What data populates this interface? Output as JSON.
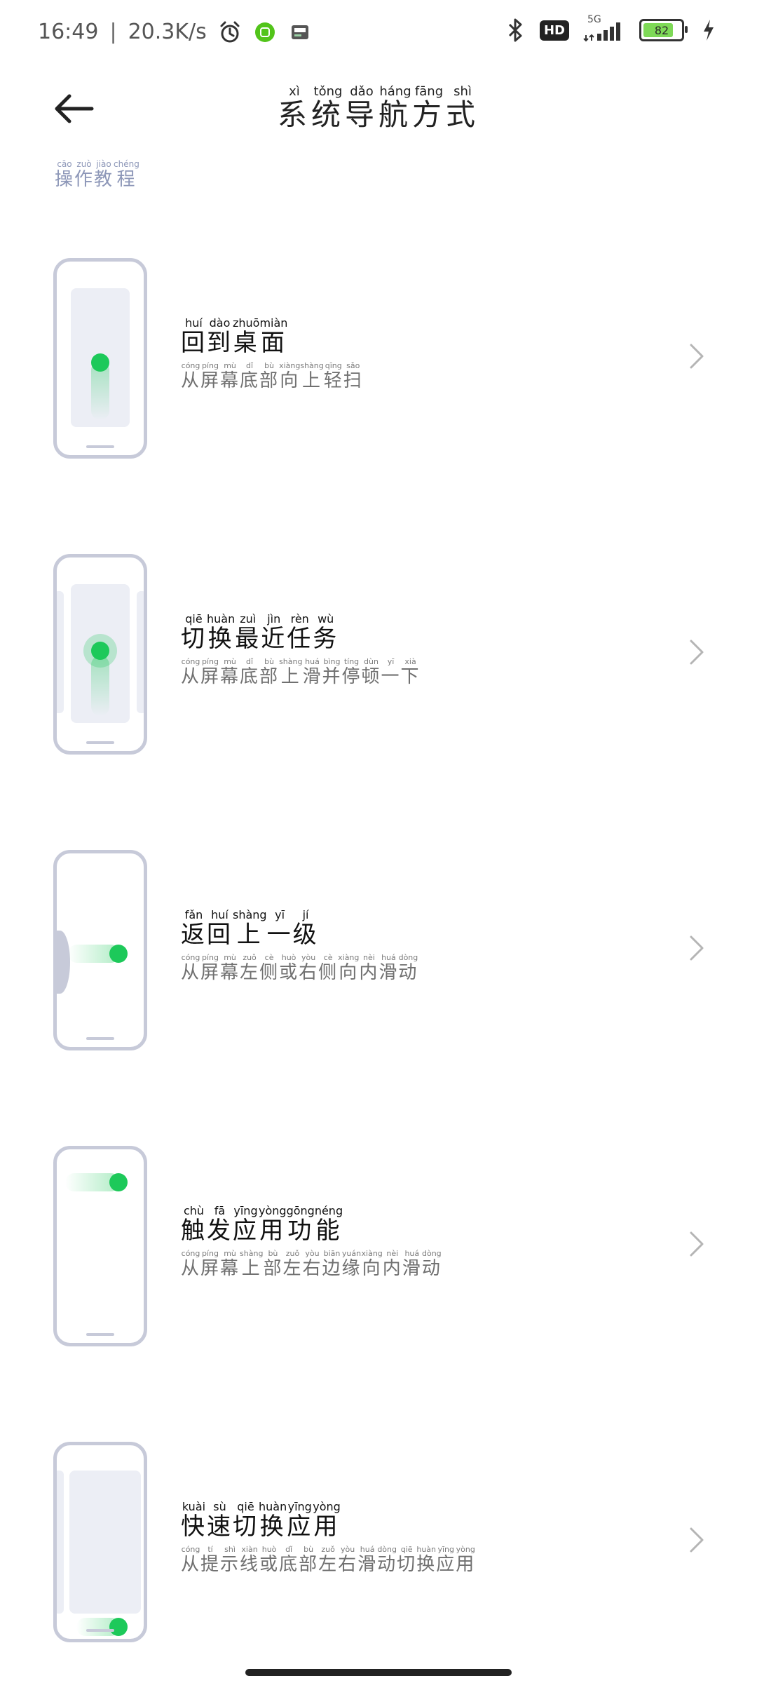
{
  "status": {
    "time": "16:49",
    "separator": "|",
    "speed": "20.3K/s",
    "icons": [
      "alarm-icon",
      "app-notification-icon",
      "image-notification-icon"
    ],
    "right_icons": [
      "bluetooth-icon",
      "hd-icon",
      "signal-5g-icon",
      "battery-icon",
      "charging-icon"
    ],
    "hd": "HD",
    "network": "5G",
    "battery": "82",
    "battery_level_percent": 82,
    "battery_color": "#7ed957"
  },
  "header": {
    "back_icon": "back-arrow-icon",
    "title_chars": [
      {
        "c": "系",
        "p": "xì"
      },
      {
        "c": "统",
        "p": "tǒng"
      },
      {
        "c": "导",
        "p": "dǎo"
      },
      {
        "c": "航",
        "p": "háng"
      },
      {
        "c": "方",
        "p": "fāng"
      },
      {
        "c": "式",
        "p": "shì"
      }
    ],
    "tutorial_chars": [
      {
        "c": "操",
        "p": "cāo"
      },
      {
        "c": "作",
        "p": "zuò"
      },
      {
        "c": "教",
        "p": "jiào"
      },
      {
        "c": "程",
        "p": "chéng"
      }
    ]
  },
  "colors": {
    "accent": "#1dc95a",
    "link": "#8d97b8",
    "phone_outline": "#c7cad9"
  },
  "items": [
    {
      "title": [
        {
          "c": "回",
          "p": "huí"
        },
        {
          "c": "到",
          "p": "dào"
        },
        {
          "c": "桌",
          "p": "zhuō"
        },
        {
          "c": "面",
          "p": "miàn"
        }
      ],
      "subtitle": [
        {
          "c": "从",
          "p": "cóng"
        },
        {
          "c": "屏",
          "p": "píng"
        },
        {
          "c": "幕",
          "p": "mù"
        },
        {
          "c": "底",
          "p": "dǐ"
        },
        {
          "c": "部",
          "p": "bù"
        },
        {
          "c": "向",
          "p": "xiàng"
        },
        {
          "c": "上",
          "p": "shàng"
        },
        {
          "c": "轻",
          "p": "qīng"
        },
        {
          "c": "扫",
          "p": "sǎo"
        }
      ]
    },
    {
      "title": [
        {
          "c": "切",
          "p": "qiē"
        },
        {
          "c": "换",
          "p": "huàn"
        },
        {
          "c": "最",
          "p": "zuì"
        },
        {
          "c": "近",
          "p": "jìn"
        },
        {
          "c": "任",
          "p": "rèn"
        },
        {
          "c": "务",
          "p": "wù"
        }
      ],
      "subtitle": [
        {
          "c": "从",
          "p": "cóng"
        },
        {
          "c": "屏",
          "p": "píng"
        },
        {
          "c": "幕",
          "p": "mù"
        },
        {
          "c": "底",
          "p": "dǐ"
        },
        {
          "c": "部",
          "p": "bù"
        },
        {
          "c": "上",
          "p": "shàng"
        },
        {
          "c": "滑",
          "p": "huá"
        },
        {
          "c": "并",
          "p": "bìng"
        },
        {
          "c": "停",
          "p": "tíng"
        },
        {
          "c": "顿",
          "p": "dùn"
        },
        {
          "c": "一",
          "p": "yī"
        },
        {
          "c": "下",
          "p": "xià"
        }
      ]
    },
    {
      "title": [
        {
          "c": "返",
          "p": "fǎn"
        },
        {
          "c": "回",
          "p": "huí"
        },
        {
          "c": "上",
          "p": "shàng"
        },
        {
          "c": "一",
          "p": "yī"
        },
        {
          "c": "级",
          "p": "jí"
        }
      ],
      "subtitle": [
        {
          "c": "从",
          "p": "cóng"
        },
        {
          "c": "屏",
          "p": "píng"
        },
        {
          "c": "幕",
          "p": "mù"
        },
        {
          "c": "左",
          "p": "zuǒ"
        },
        {
          "c": "侧",
          "p": "cè"
        },
        {
          "c": "或",
          "p": "huò"
        },
        {
          "c": "右",
          "p": "yòu"
        },
        {
          "c": "侧",
          "p": "cè"
        },
        {
          "c": "向",
          "p": "xiàng"
        },
        {
          "c": "内",
          "p": "nèi"
        },
        {
          "c": "滑",
          "p": "huá"
        },
        {
          "c": "动",
          "p": "dòng"
        }
      ]
    },
    {
      "title": [
        {
          "c": "触",
          "p": "chù"
        },
        {
          "c": "发",
          "p": "fā"
        },
        {
          "c": "应",
          "p": "yīng"
        },
        {
          "c": "用",
          "p": "yòng"
        },
        {
          "c": "功",
          "p": "gōng"
        },
        {
          "c": "能",
          "p": "néng"
        }
      ],
      "subtitle": [
        {
          "c": "从",
          "p": "cóng"
        },
        {
          "c": "屏",
          "p": "píng"
        },
        {
          "c": "幕",
          "p": "mù"
        },
        {
          "c": "上",
          "p": "shàng"
        },
        {
          "c": "部",
          "p": "bù"
        },
        {
          "c": "左",
          "p": "zuǒ"
        },
        {
          "c": "右",
          "p": "yòu"
        },
        {
          "c": "边",
          "p": "biān"
        },
        {
          "c": "缘",
          "p": "yuán"
        },
        {
          "c": "向",
          "p": "xiàng"
        },
        {
          "c": "内",
          "p": "nèi"
        },
        {
          "c": "滑",
          "p": "huá"
        },
        {
          "c": "动",
          "p": "dòng"
        }
      ]
    },
    {
      "title": [
        {
          "c": "快",
          "p": "kuài"
        },
        {
          "c": "速",
          "p": "sù"
        },
        {
          "c": "切",
          "p": "qiē"
        },
        {
          "c": "换",
          "p": "huàn"
        },
        {
          "c": "应",
          "p": "yīng"
        },
        {
          "c": "用",
          "p": "yòng"
        }
      ],
      "subtitle": [
        {
          "c": "从",
          "p": "cóng"
        },
        {
          "c": "提",
          "p": "tí"
        },
        {
          "c": "示",
          "p": "shì"
        },
        {
          "c": "线",
          "p": "xiàn"
        },
        {
          "c": "或",
          "p": "huò"
        },
        {
          "c": "底",
          "p": "dǐ"
        },
        {
          "c": "部",
          "p": "bù"
        },
        {
          "c": "左",
          "p": "zuǒ"
        },
        {
          "c": "右",
          "p": "yòu"
        },
        {
          "c": "滑",
          "p": "huá"
        },
        {
          "c": "动",
          "p": "dòng"
        },
        {
          "c": "切",
          "p": "qiē"
        },
        {
          "c": "换",
          "p": "huàn"
        },
        {
          "c": "应",
          "p": "yīng"
        },
        {
          "c": "用",
          "p": "yòng"
        }
      ]
    }
  ]
}
